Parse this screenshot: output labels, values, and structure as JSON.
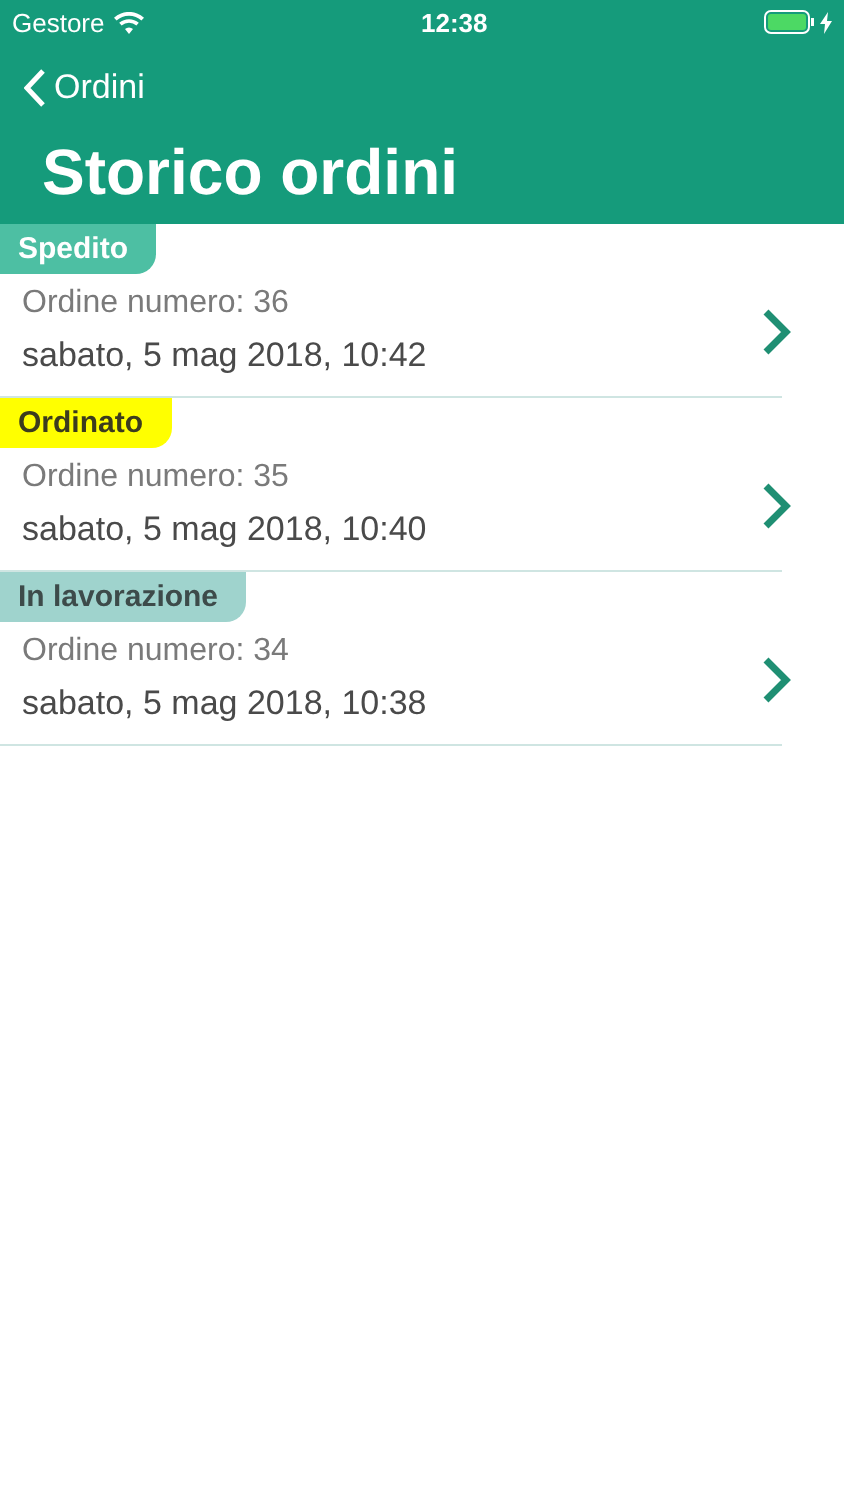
{
  "status_bar": {
    "carrier": "Gestore",
    "time": "12:38",
    "charging": true
  },
  "nav": {
    "back": "Ordini",
    "title": "Storico ordini"
  },
  "orders": [
    {
      "status": "Spedito",
      "color": "#4dbfa3",
      "number": "Ordine numero: 36",
      "date": "sabato, 5 mag 2018, 10:42"
    },
    {
      "status": "Ordinato",
      "color": "#ffff00",
      "number": "Ordine numero: 35",
      "date": "sabato, 5 mag 2018, 10:40"
    },
    {
      "status": "In lavorazione",
      "color": "#9fd3cd",
      "number": "Ordine numero: 34",
      "date": "sabato, 5 mag 2018, 10:38"
    }
  ]
}
